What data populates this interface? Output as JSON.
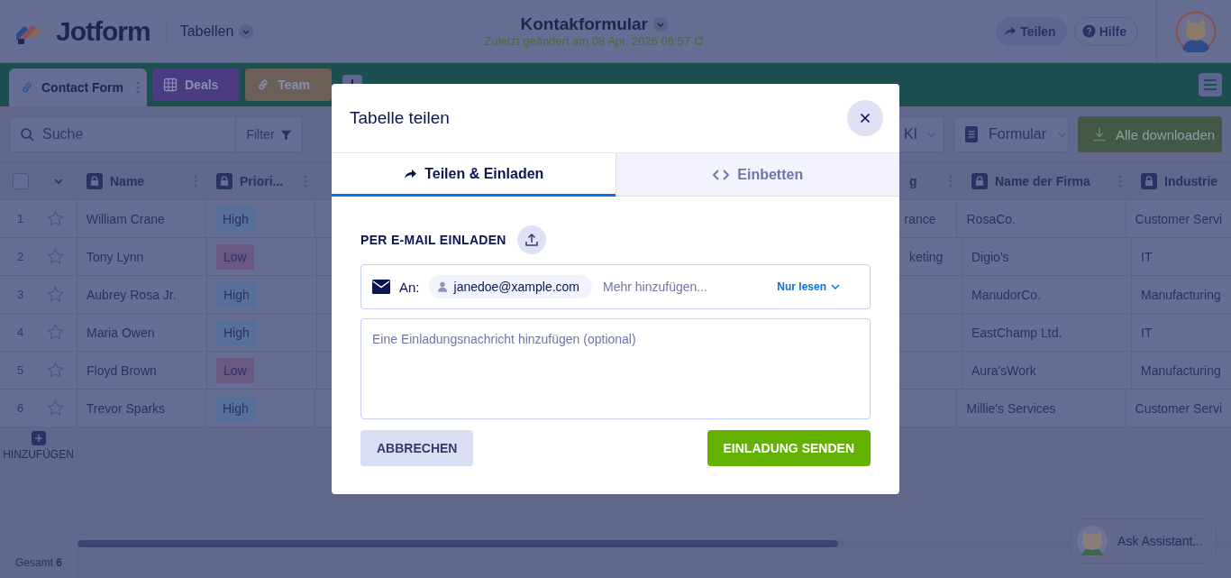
{
  "header": {
    "brand": "Jotform",
    "section_menu": "Tabellen",
    "title": "Kontakformular",
    "subtitle": "Zuletzt geändert am 08 Apr. 2026 06:57",
    "share_button": "Teilen",
    "help_button": "Hilfe"
  },
  "tabs": [
    {
      "label": "Contact Form",
      "kind": "link",
      "color": "#676e93",
      "selected": true
    },
    {
      "label": "Deals",
      "kind": "grid",
      "color": "#4a3b83",
      "selected": false
    },
    {
      "label": "Team",
      "kind": "link",
      "color": "#6c5f58",
      "selected": false
    }
  ],
  "toolbar": {
    "search_placeholder": "Suche",
    "filter_button": "Filter",
    "ai_button": "KI",
    "form_button": "Formular",
    "download_button": "Alle downloaden"
  },
  "table": {
    "all_selected": false,
    "columns": [
      "Name",
      "Priori...",
      "g",
      "Name der Firma",
      "Industrie"
    ],
    "rows": [
      {
        "number": "1",
        "starred": false,
        "name": "William Crane",
        "priority": {
          "label": "High",
          "color": "#56709a"
        },
        "column_3": "rance",
        "company": "RosaCo.",
        "industry": "Customer Servi"
      },
      {
        "number": "2",
        "starred": false,
        "name": "Tony Lynn",
        "priority": {
          "label": "Low",
          "color": "#6b5880"
        },
        "column_3": "keting",
        "company": "Digio's",
        "industry": "IT"
      },
      {
        "number": "3",
        "starred": false,
        "name": "Aubrey Rosa Jr.",
        "priority": {
          "label": "High",
          "color": "#56709a"
        },
        "company": "ManudorCo.",
        "industry": "Manufacturing"
      },
      {
        "number": "4",
        "starred": false,
        "name": "Maria Owen",
        "priority": {
          "label": "High",
          "color": "#56709a"
        },
        "company": "EastChamp Ltd.",
        "industry": "IT"
      },
      {
        "number": "5",
        "starred": false,
        "name": "Floyd Brown",
        "priority": {
          "label": "Low",
          "color": "#6b5880"
        },
        "company": "Aura'sWork",
        "industry": "Manufacturing"
      },
      {
        "number": "6",
        "starred": false,
        "name": "Trevor Sparks",
        "priority": {
          "label": "High",
          "color": "#56709a"
        },
        "company": "Millie's Services",
        "industry": "Customer Servi"
      }
    ],
    "add_row": "HINZUFÜGEN"
  },
  "footer": {
    "total": "Gesamt **6**"
  },
  "assistant_button": "Ask Assistant...",
  "dialog": {
    "title": "Tabelle teilen",
    "tabs": [
      {
        "label": "Teilen & Einladen",
        "kind": "share",
        "selected": true
      },
      {
        "label": "Einbetten",
        "kind": "code",
        "selected": false
      }
    ],
    "section_title": "PER E-MAIL EINLADEN",
    "to_label": "An:",
    "recipients": [
      "janedoe@xample.com"
    ],
    "add_placeholder": "Mehr hinzufügen...",
    "permission": "Nur lesen",
    "message_placeholder": "Eine Einladungsnachricht hinzufügen (optional)",
    "cancel_button": "ABBRECHEN",
    "send_button": "EINLADUNG SENDEN"
  }
}
